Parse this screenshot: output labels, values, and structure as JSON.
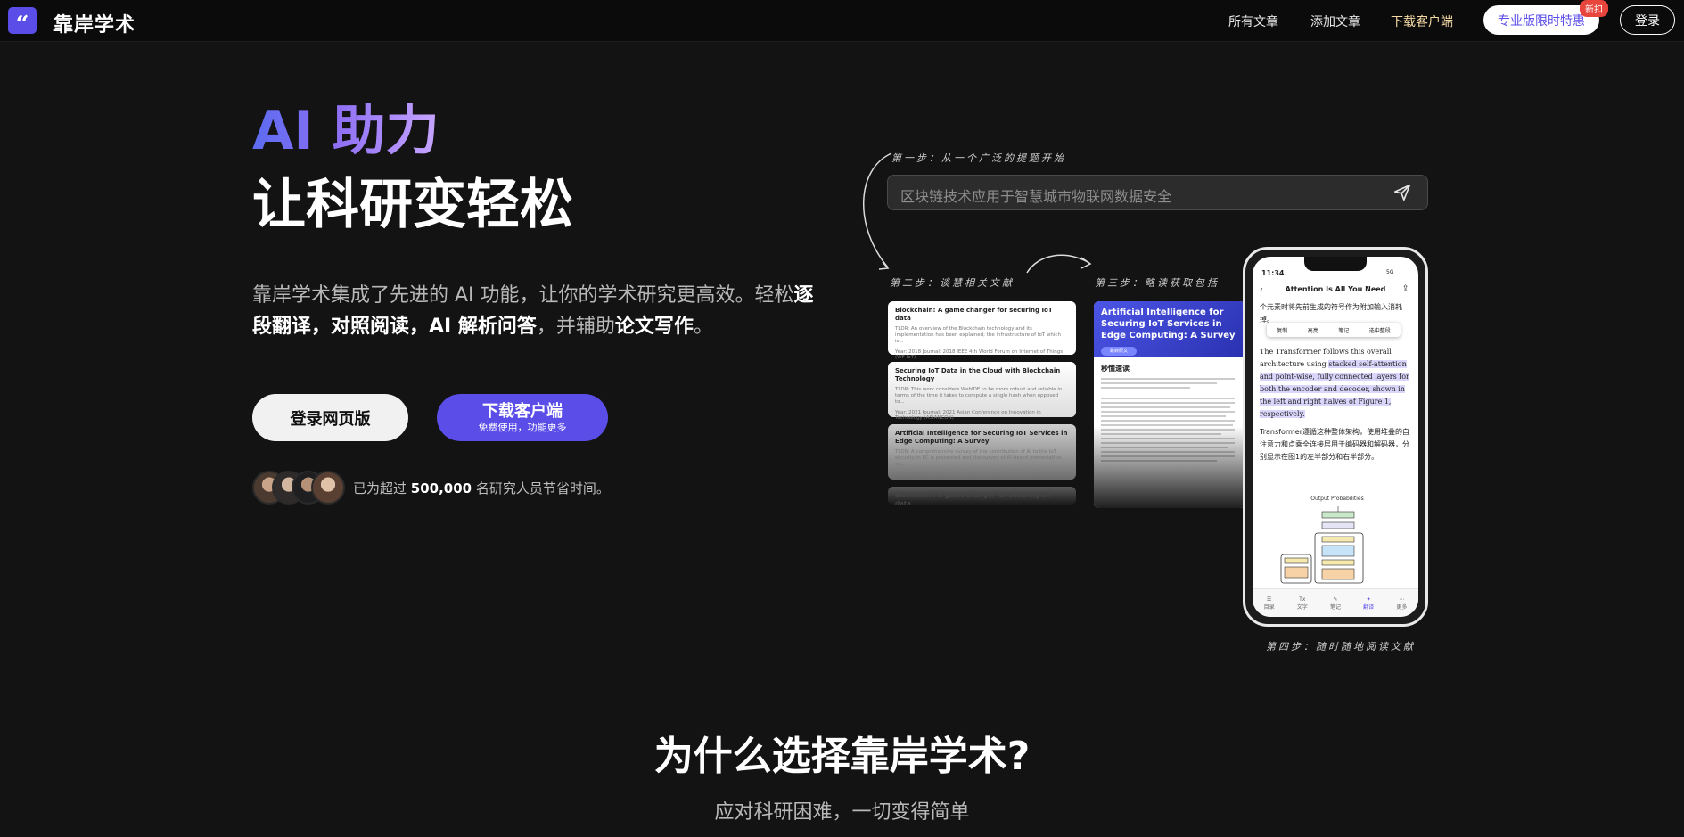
{
  "nav": {
    "logo_glyph": "“",
    "brand": "靠岸学术",
    "links": [
      "所有文章",
      "添加文章",
      "下载客户端"
    ],
    "pro_button": "专业版限时特惠",
    "pro_badge": "新扣",
    "login": "登录"
  },
  "hero": {
    "line1": "AI 助力",
    "line2": "让科研变轻松",
    "desc_parts": {
      "p1": "靠岸学术集成了先进的 AI 功能，让你的学术研究更高效。轻松",
      "b1": "逐段翻译，对照阅读，AI 解析问答",
      "p2": "，并辅助",
      "b2": "论文写作",
      "p3": "。"
    },
    "btn_web": "登录网页版",
    "btn_download": "下载客户端",
    "btn_download_sub": "免费使用，功能更多",
    "stat_prefix": "已为超过 ",
    "stat_number": "500,000",
    "stat_suffix": " 名研究人员节省时间。"
  },
  "illustration": {
    "step1": "第一步：从一个广泛的提题开始",
    "step2": "第二步：谈慧相关文献",
    "step3": "第三步：略读获取包括",
    "step4": "第四步：随时随地阅读文献",
    "search_text": "区块链技术应用于智慧城市物联网数据安全",
    "cards": [
      {
        "title": "Blockchain: A game changer for securing IoT data",
        "summary": "TLDR: An overview of the Blockchain technology and its implementation has been explained; the infrastructure of IoT which is...",
        "meta": "Year: 2018 Journal: 2018 IEEE 4th World Forum on Internet of Things (WF-IoT)"
      },
      {
        "title": "Securing IoT Data in the Cloud with Blockchain Technology",
        "summary": "TLDR: This work considers WebIDE to be more robust and reliable in terms of the time it takes to compute a single hash when opposed to...",
        "meta": "Year: 2021 Journal: 2021 Asian Conference on Innovation in Technology (ASIANCON)"
      },
      {
        "title": "Artificial Intelligence for Securing IoT Services in Edge Computing: A Survey",
        "summary": "TLDR: A comprehensive survey of the contribution of AI to the IoT security in EC is presented and the survey of AI-based preventative, ex...",
        "meta": "Year: 2020 Journal: Security Communication Networks"
      },
      {
        "title": "Blockchain: A game changer for securing IoT data",
        "summary": "",
        "meta": ""
      }
    ],
    "article_title": "Artificial Intelligence for Securing IoT Services in Edge Computing: A Survey",
    "article_badge": "跳转原文",
    "article_sub": "秒懂速读",
    "phone": {
      "time": "11:34",
      "status": "5G",
      "title": "Attention Is All You Need",
      "text_top": "个元素时将先前生成的符号作为附加输入消耗掉。",
      "popup": [
        "复制",
        "高亮",
        "笔记",
        "选中整段"
      ],
      "text_en_pre": "The Transformer follows this overall architecture using ",
      "text_en_hl": "stacked self-attention and point-wise, fully connected layers for both the encoder and decoder, shown in the left and right halves of Figure 1, respectively.",
      "text_cn": "Transformer遵循这种整体架构，使用堆叠的自注意力和点乘全连接层用于编码器和解码器，分别显示在图1的左半部分和右半部分。",
      "diagram_label": "Output Probabilities",
      "tabs": [
        "目录",
        "文字",
        "笔记",
        "翻译",
        "更多"
      ]
    }
  },
  "section": {
    "title": "为什么选择靠岸学术?",
    "subtitle": "应对科研困难，一切变得简单"
  }
}
